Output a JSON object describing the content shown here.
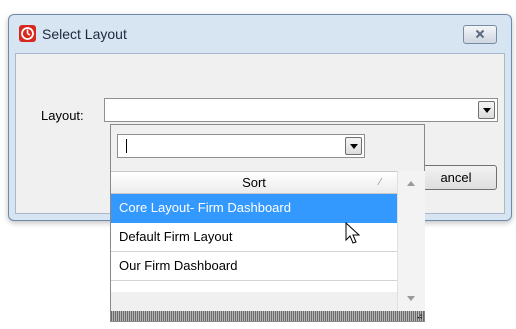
{
  "window": {
    "title": "Select Layout",
    "icon": "app-logo-icon",
    "close_icon": "close-icon"
  },
  "form": {
    "layout_label": "Layout:",
    "layout_value": ""
  },
  "buttons": {
    "cancel_label": "ancel"
  },
  "dropdown": {
    "filter_value": "",
    "column_header": "Sort",
    "items": [
      {
        "label": "Core Layout- Firm Dashboard",
        "selected": true
      },
      {
        "label": "Default Firm Layout",
        "selected": false
      },
      {
        "label": "Our Firm Dashboard",
        "selected": false
      }
    ]
  },
  "colors": {
    "selection": "#3399ff",
    "dialog_frame": "#d7e4f2",
    "app_icon": "#d8281e"
  }
}
